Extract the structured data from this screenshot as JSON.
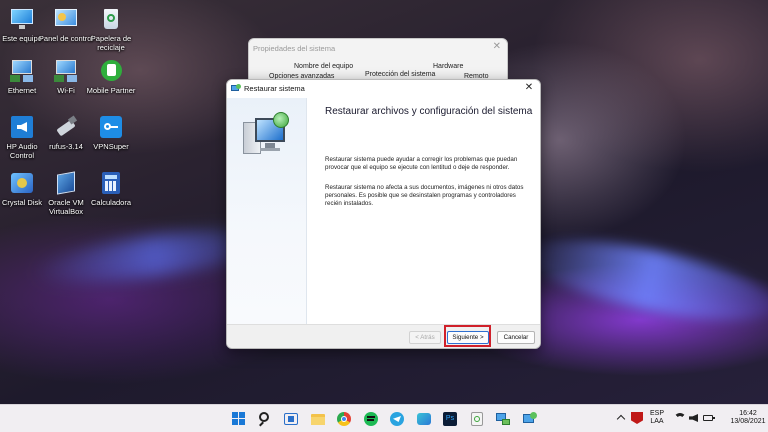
{
  "desktop": {
    "icons": [
      {
        "label": "Este equipo"
      },
      {
        "label": "Panel de control"
      },
      {
        "label": "Papelera de reciclaje"
      },
      {
        "label": "Ethernet"
      },
      {
        "label": "Wi-Fi"
      },
      {
        "label": "Mobile Partner"
      },
      {
        "label": "HP Audio Control"
      },
      {
        "label": "rufus-3.14"
      },
      {
        "label": "VPNSuper"
      },
      {
        "label": "Crystal Disk"
      },
      {
        "label": "Oracle VM VirtualBox"
      },
      {
        "label": "Calculadora"
      }
    ]
  },
  "back_dialog": {
    "title": "Propiedades del sistema",
    "tabs": [
      "Nombre del equipo",
      "Hardware",
      "Opciones avanzadas",
      "Protección del sistema",
      "Remoto"
    ]
  },
  "dialog": {
    "title": "Restaurar sistema",
    "heading": "Restaurar archivos y configuración del sistema",
    "paragraph1": "Restaurar sistema puede ayudar a corregir los problemas que puedan provocar que el equipo se ejecute con lentitud o deje de responder.",
    "paragraph2": "Restaurar sistema no afecta a sus documentos, imágenes ni otros datos personales. Es posible que se desinstalen programas y controladores recién instalados.",
    "buttons": {
      "back": "< Atrás",
      "next": "Siguiente >",
      "cancel": "Cancelar"
    }
  },
  "taskbar": {
    "language_line1": "ESP",
    "language_line2": "LAA",
    "time": "16:42",
    "date": "13/08/2021"
  },
  "colors": {
    "highlight": "#d0202a",
    "accent": "#2f6fd0"
  }
}
